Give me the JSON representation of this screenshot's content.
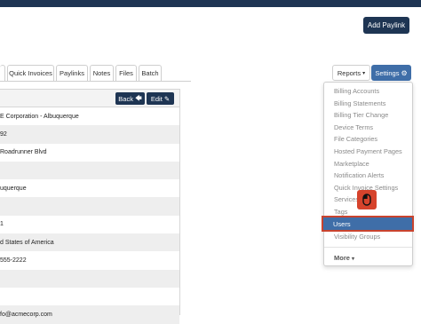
{
  "header": {
    "add_paylink_label": "Add Paylink"
  },
  "tabs": [
    "Quick Invoices",
    "Paylinks",
    "Notes",
    "Files",
    "Batch"
  ],
  "toolbar": {
    "reports_label": "Reports",
    "settings_label": "Settings"
  },
  "panel": {
    "back_label": "Back",
    "edit_label": "Edit",
    "rows": [
      "E Corporation - Albuquerque",
      "92",
      "Roadrunner Blvd",
      "",
      "uquerque",
      "",
      "1",
      "d States of America",
      " 555-2222",
      "",
      "",
      "fo@acmecorp.com"
    ]
  },
  "settings_menu": {
    "items": [
      "Billing Accounts",
      "Billing Statements",
      "Billing Tier Change",
      "Device Terms",
      "File Categories",
      "Hosted Payment Pages",
      "Marketplace",
      "Notification Alerts",
      "Quick Invoice Settings",
      "Services",
      "Tags",
      "Users",
      "Visibility Groups"
    ],
    "more_label": "More"
  },
  "colors": {
    "navy": "#1e3553",
    "accent": "#3f6ea8",
    "highlight": "#c9432e"
  }
}
